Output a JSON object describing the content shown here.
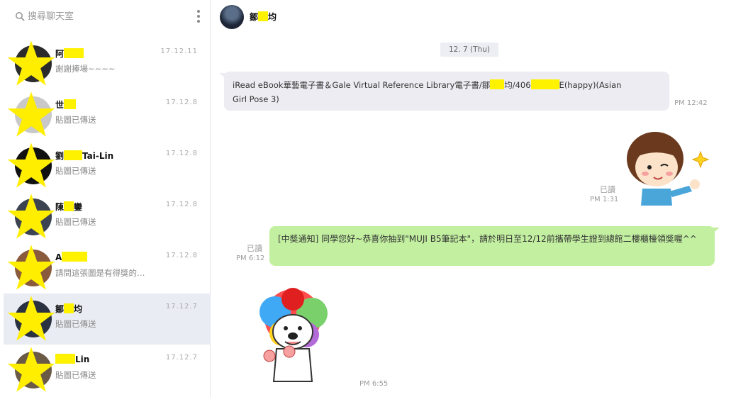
{
  "search": {
    "placeholder": "搜尋聊天室"
  },
  "header": {
    "contact_name_prefix": "鄒",
    "contact_name_suffix": "均"
  },
  "chats": [
    {
      "name_prefix": "阿",
      "name_suffix": "",
      "preview": "謝謝捧場~~~~",
      "date": "17.12.11"
    },
    {
      "name_prefix": "世",
      "name_suffix": "",
      "preview": "貼圖已傳送",
      "date": "17.12.8"
    },
    {
      "name_prefix": "劉",
      "name_suffix": "Tai-Lin",
      "preview": "貼圖已傳送",
      "date": "17.12.8"
    },
    {
      "name_prefix": "陳",
      "name_suffix": "鑾",
      "preview": "貼圖已傳送",
      "date": "17.12.8"
    },
    {
      "name_prefix": "A",
      "name_suffix": "",
      "preview": "請問這張圖是有得獎的…",
      "date": "17.12.8"
    },
    {
      "name_prefix": "鄒",
      "name_suffix": "均",
      "preview": "貼圖已傳送",
      "date": "17.12.7"
    },
    {
      "name_prefix": "",
      "name_suffix": "Lin",
      "preview": "貼圖已傳送",
      "date": "17.12.7"
    }
  ],
  "messages": {
    "date_chip": "12. 7 (Thu)",
    "incoming_text_a": "iRead eBook華藝電子書＆Gale Virtual Reference Library電子書/鄒",
    "incoming_text_b": "均/406",
    "incoming_text_c": "E(happy)(Asian",
    "incoming_text_d": "Girl Pose 3)",
    "incoming_time": "PM 12:42",
    "sticker1_read": "已讀",
    "sticker1_time": "PM 1:31",
    "outgoing_read": "已讀",
    "outgoing_time": "PM 6:12",
    "outgoing_text": "[中獎通知] 同學您好~恭喜你抽到\"MUJI B5筆記本\"，請於明日至12/12前攜帶學生證到總館二樓櫃檯領獎喔^^",
    "sticker2_time": "PM 6:55"
  }
}
